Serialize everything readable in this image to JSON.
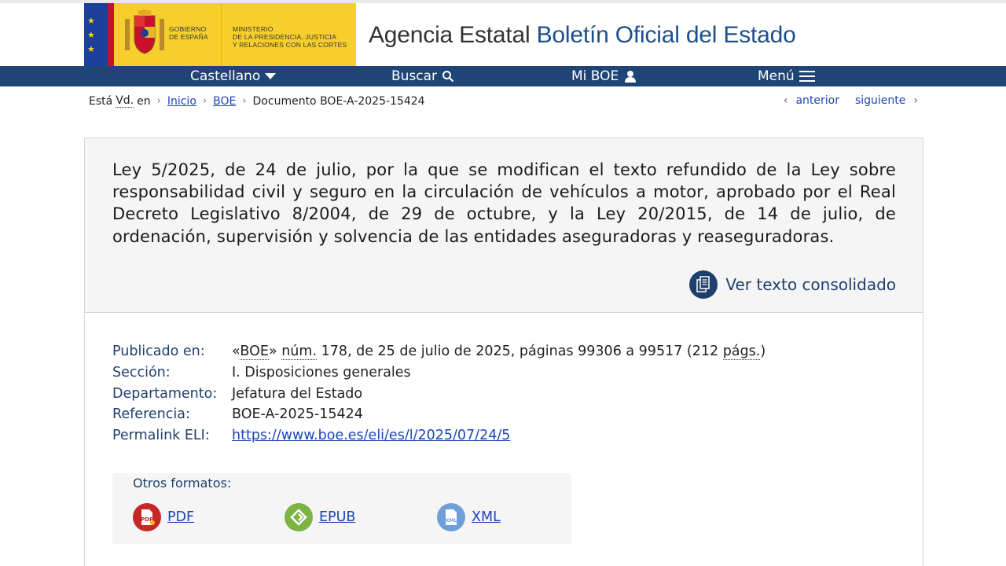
{
  "header": {
    "gov_line1": "GOBIERNO",
    "gov_line2": "DE ESPAÑA",
    "ministry_line1": "MINISTERIO",
    "ministry_line2": "DE LA PRESIDENCIA, JUSTICIA",
    "ministry_line3": "Y RELACIONES CON LAS CORTES",
    "title_plain": "Agencia Estatal ",
    "title_accent": "Boletín Oficial del Estado",
    "colors": {
      "flag_blue": "#1b3f9a",
      "yellow": "#f7cf2c",
      "accent": "#1c4f8c"
    }
  },
  "nav": {
    "language": "Castellano",
    "search": "Buscar",
    "my_boe": "Mi BOE",
    "menu": "Menú",
    "bar_color": "#1f4476"
  },
  "breadcrumb": {
    "prefix_1": "Está",
    "prefix_abbr": "Vd.",
    "prefix_2": "en",
    "items": [
      {
        "label": "Inicio"
      },
      {
        "label": "BOE"
      },
      {
        "label": "Documento BOE-A-2025-15424"
      }
    ],
    "prev": "anterior",
    "next": "siguiente"
  },
  "document": {
    "title": "Ley 5/2025, de 24 de julio, por la que se modifican el texto refundido de la Ley sobre responsabilidad civil y seguro en la circulación de vehículos a motor, aprobado por el Real Decreto Legislativo 8/2004, de 29 de octubre, y la Ley 20/2015, de 14 de julio, de ordenación, supervisión y solvencia de las entidades aseguradoras y reaseguradoras.",
    "consolidated_link": "Ver texto consolidado"
  },
  "metadata": {
    "published_label": "Publicado en:",
    "published_open": "«",
    "published_boe": "BOE",
    "published_close": "» ",
    "published_num_abbr": "núm.",
    "published_rest": " 178, de 25 de julio de 2025, páginas 99306 a 99517 (212 ",
    "published_pags_abbr": "págs.",
    "published_end": ")",
    "section_label": "Sección:",
    "section_value": "I. Disposiciones generales",
    "department_label": "Departamento:",
    "department_value": "Jefatura del Estado",
    "reference_label": "Referencia:",
    "reference_value": "BOE-A-2025-15424",
    "eli_label": "Permalink ELI:",
    "eli_value": "https://www.boe.es/eli/es/l/2025/07/24/5"
  },
  "formats": {
    "label": "Otros formatos:",
    "items": [
      {
        "label": "PDF",
        "icon": "pdf-icon",
        "color": "#c62828"
      },
      {
        "label": "EPUB",
        "icon": "epub-icon",
        "color": "#7cb342"
      },
      {
        "label": "XML",
        "icon": "xml-icon",
        "color": "#6f9fd8"
      }
    ]
  }
}
